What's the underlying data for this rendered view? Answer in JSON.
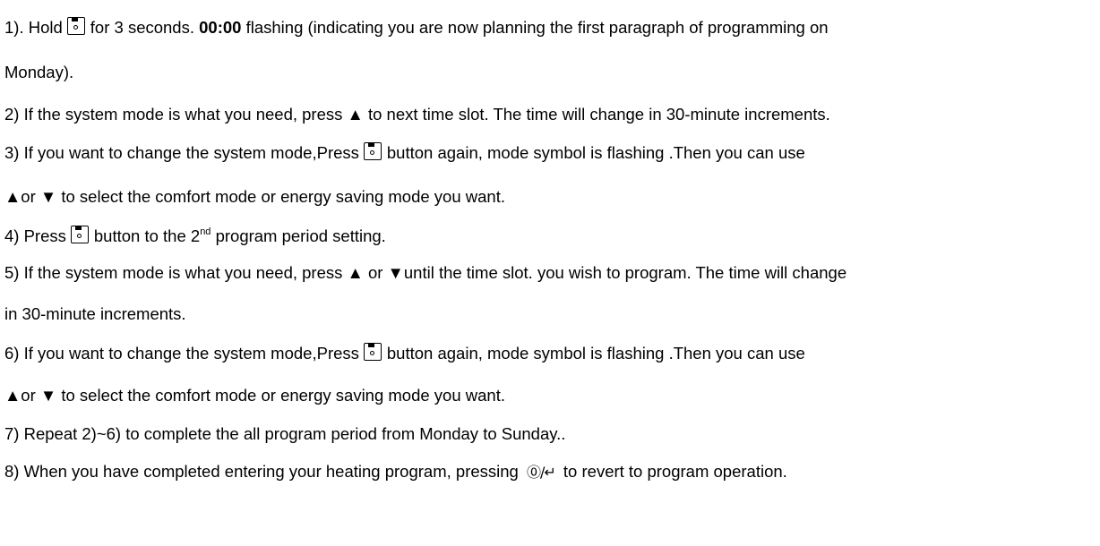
{
  "steps": {
    "s1": {
      "pre": "1). Hold",
      "mid1": "for 3 seconds.",
      "bold": "00:00",
      "post": "flashing (indicating you are now planning the first paragraph of programming on",
      "cont": "Monday)."
    },
    "s2": {
      "text": "2) If the system mode is what you need, press ▲ to next time slot. The time will change in 30-minute increments."
    },
    "s3": {
      "pre": "3) If you want to change the system mode,Press",
      "post": "button again, mode symbol is flashing .Then you can use",
      "cont": "▲or ▼ to select the comfort mode or energy saving mode you want."
    },
    "s4": {
      "pre": "4) Press",
      "mid": "button to the 2",
      "sup": "nd",
      "post": "program period setting."
    },
    "s5": {
      "text": "5) If the system mode is what you need, press ▲ or ▼until the time slot. you wish to program. The time will change",
      "cont": "in 30-minute increments."
    },
    "s6": {
      "pre": "6) If you want to change the system mode,Press",
      "post": "button again, mode symbol is flashing .Then you can use",
      "cont": "▲or ▼ to select the comfort mode or energy saving mode you want."
    },
    "s7": {
      "text": "7) Repeat 2)~6) to complete the all program period from Monday to Sunday.."
    },
    "s8": {
      "pre": "8) When you have completed entering your heating program, pressing",
      "icon": "⓪/↵",
      "post": "to revert to program operation."
    }
  },
  "icons": {
    "program_button": "save-program-icon",
    "return_button": "run-return-icon"
  }
}
